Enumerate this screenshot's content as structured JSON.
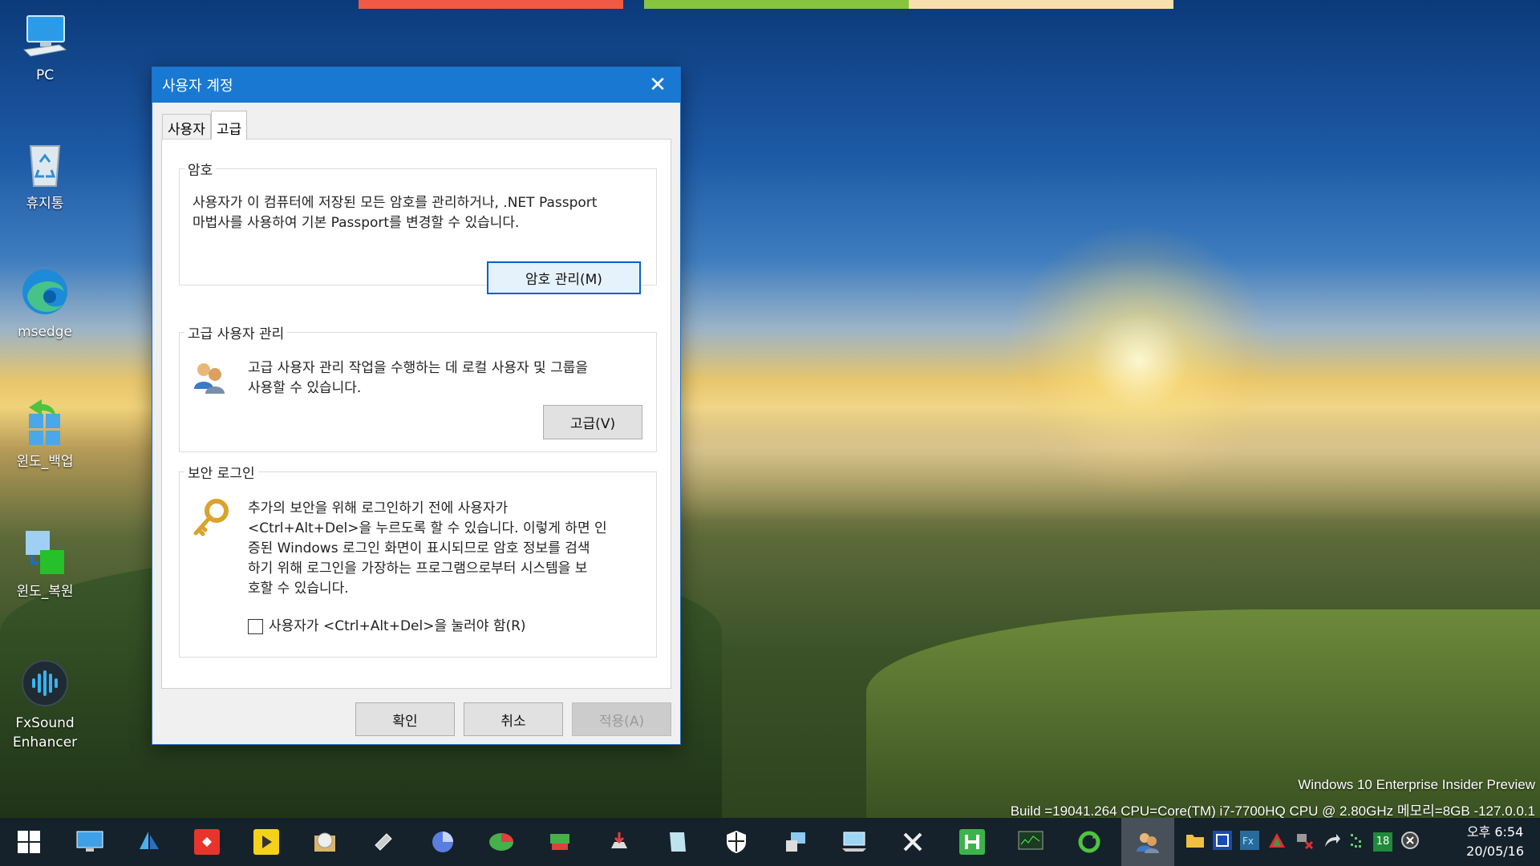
{
  "top_strip_colors": [
    "#f05a44",
    "#87c440",
    "#f7dfae"
  ],
  "desktop_icons": [
    {
      "label": "PC",
      "icon": "monitor-icon"
    },
    {
      "label": "휴지통",
      "icon": "recycle-bin-icon"
    },
    {
      "label": "msedge",
      "icon": "edge-icon"
    },
    {
      "label": "윈도_백업",
      "icon": "backup-icon"
    },
    {
      "label": "윈도_복원",
      "icon": "restore-icon"
    },
    {
      "label": "FxSound\nEnhancer",
      "icon": "fxsound-icon"
    }
  ],
  "dialog": {
    "title": "사용자 계정",
    "tabs": [
      "사용자",
      "고급"
    ],
    "active_tab": "고급",
    "password": {
      "legend": "암호",
      "description_line1": "사용자가 이 컴퓨터에 저장된 모든 암호를 관리하거나, .NET Passport",
      "description_line2": "마법사를 사용하여 기본 Passport를 변경할 수 있습니다.",
      "button": "암호 관리(M)"
    },
    "advanced": {
      "legend": "고급 사용자 관리",
      "description_line1": "고급 사용자 관리 작업을 수행하는 데 로컬 사용자 및 그룹을",
      "description_line2": "사용할 수 있습니다.",
      "button": "고급(V)"
    },
    "secure_logon": {
      "legend": "보안 로그인",
      "lines": [
        "추가의 보안을 위해 로그인하기 전에 사용자가",
        "<Ctrl+Alt+Del>을 누르도록 할 수 있습니다. 이렇게 하면 인",
        "증된 Windows 로그인 화면이 표시되므로 암호 정보를 검색",
        "하기 위해 로그인을 가장하는 프로그램으로부터 시스템을 보",
        "호할 수 있습니다."
      ],
      "checkbox_label": "사용자가 <Ctrl+Alt+Del>을 눌러야 함(R)",
      "checkbox_checked": false
    },
    "ok": "확인",
    "cancel": "취소",
    "apply": "적용(A)"
  },
  "watermark": {
    "line1": "Windows 10 Enterprise Insider Preview",
    "line2": "Build =19041.264  CPU=Core(TM) i7-7700HQ CPU @ 2.80GHz 메모리=8GB  -127.0.0.1"
  },
  "taskbar": {
    "items": [
      "start-icon",
      "display-settings-icon",
      "sailboat-icon",
      "anydesk-icon",
      "potplayer-icon",
      "disc-burner-icon",
      "usb-icon",
      "disk-utility-icon",
      "partition-tool-icon",
      "network-tool-icon",
      "installer-icon",
      "notepad-icon",
      "defender-icon",
      "image-tool-icon",
      "remote-desktop-icon",
      "tools-icon",
      "hwp-icon",
      "monitor-tool-icon",
      "sync-icon",
      "user-accounts-icon"
    ],
    "active_index": 19,
    "tray_badge": "18",
    "clock_ampm_time": "오후 6:54",
    "clock_date": "20/05/16"
  }
}
